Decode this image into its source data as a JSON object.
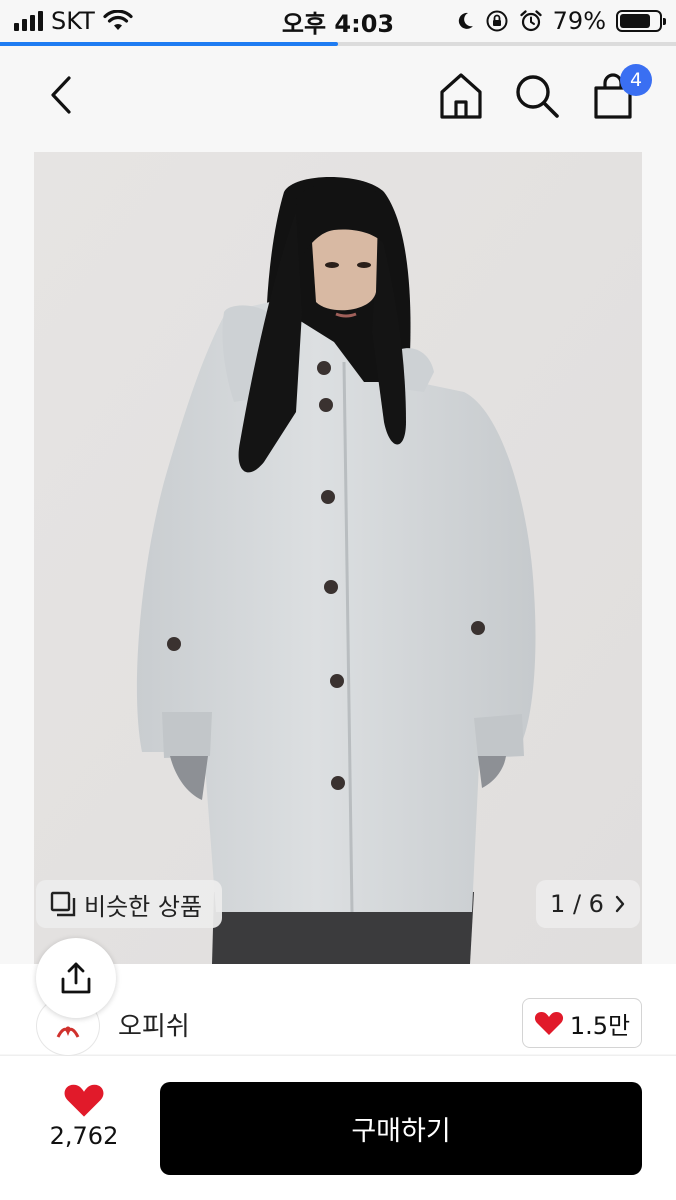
{
  "status_bar": {
    "carrier": "SKT",
    "time": "오후 4:03",
    "battery_percent_label": "79%",
    "battery_level": 0.79,
    "page_load_progress": 0.5
  },
  "nav": {
    "back_icon": "chevron-left-icon",
    "home_icon": "home-icon",
    "search_icon": "search-icon",
    "cart_icon": "shopping-bag-icon",
    "cart_badge": "4",
    "badge_color": "#3a6ff2"
  },
  "product_image": {
    "similar_label": "비슷한 상품",
    "page_indicator": "1 / 6"
  },
  "brand": {
    "name": "오피쉬",
    "like_count": "1.5만"
  },
  "bottom": {
    "wish_count": "2,762",
    "buy_label": "구매하기",
    "heart_color": "#e11a2a"
  }
}
